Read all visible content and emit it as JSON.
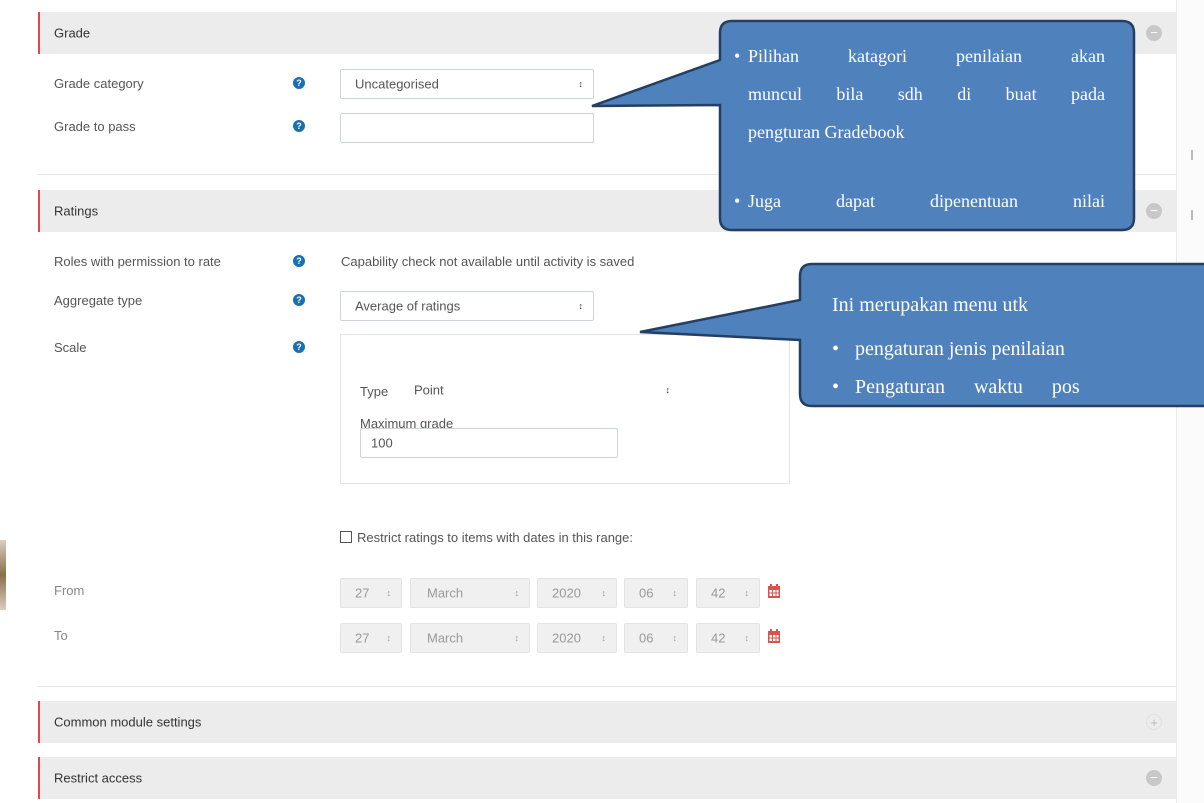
{
  "sections": {
    "grade": {
      "title": "Grade"
    },
    "ratings": {
      "title": "Ratings"
    },
    "common": {
      "title": "Common module settings"
    },
    "restrict": {
      "title": "Restrict access"
    }
  },
  "grade": {
    "category_label": "Grade category",
    "category_value": "Uncategorised",
    "pass_label": "Grade to pass",
    "pass_value": ""
  },
  "ratings": {
    "roles_label": "Roles with permission to rate",
    "roles_value": "Capability check not available until activity is saved",
    "aggregate_label": "Aggregate type",
    "aggregate_value": "Average of ratings",
    "scale_label": "Scale",
    "type_label": "Type",
    "type_value": "Point",
    "max_label": "Maximum grade",
    "max_value": "100",
    "restrict_label": "Restrict ratings to items with dates in this range:",
    "from_label": "From",
    "to_label": "To",
    "from": {
      "day": "27",
      "month": "March",
      "year": "2020",
      "hour": "06",
      "minute": "42"
    },
    "to": {
      "day": "27",
      "month": "March",
      "year": "2020",
      "hour": "06",
      "minute": "42"
    }
  },
  "callout1": {
    "line1": "Pilihan katagori penilaian akan",
    "line2": "muncul bila sdh di buat pada",
    "line3": "pengturan Gradebook",
    "line4": "Juga dapat dipenentuan nilai"
  },
  "callout2": {
    "line1": "Ini merupakan menu utk",
    "item1": "pengaturan jenis penilaian",
    "item2": "Pengaturan waktu pos"
  },
  "icons": {
    "select_arrow": "↕",
    "help": "?",
    "collapse": "−",
    "expand": "+"
  },
  "colors": {
    "callout_fill": "#4f81bd",
    "callout_border": "#243f60",
    "section_accent": "#e0464f",
    "help_icon": "#1a6fb0",
    "calendar_icon": "#c9302c"
  }
}
